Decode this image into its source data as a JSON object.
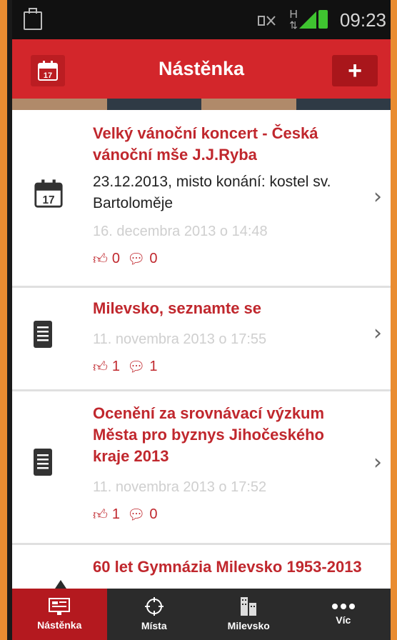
{
  "status_bar": {
    "time": "09:23",
    "network_label": "H"
  },
  "header": {
    "title": "Nástěnka",
    "calendar_day": "17",
    "add_symbol": "+"
  },
  "colors": {
    "accent": "#d3262b",
    "accent_dark": "#a9161b",
    "nav_bg": "#2b2b2b"
  },
  "items": [
    {
      "type": "event",
      "title": "Velký vánoční koncert - Česká vánoční mše J.J.Ryba",
      "description": "23.12.2013, misto konání:  kostel sv. Bartoloměje",
      "icon_day": "17",
      "date": "16. decembra 2013 o 14:48",
      "likes": "0",
      "comments": "0"
    },
    {
      "type": "article",
      "title": "Milevsko, seznamte se",
      "date": "11. novembra 2013 o 17:55",
      "likes": "1",
      "comments": "1"
    },
    {
      "type": "article",
      "title": "Ocenění za srovnávací výzkum Města pro byznys Jihočeského kraje 2013",
      "date": "11. novembra 2013 o 17:52",
      "likes": "1",
      "comments": "0"
    },
    {
      "type": "article",
      "title": "60 let Gymnázia Milevsko 1953-2013"
    }
  ],
  "bottom_nav": [
    {
      "label": "Nástěnka",
      "icon": "board-icon",
      "active": true
    },
    {
      "label": "Místa",
      "icon": "target-icon",
      "active": false
    },
    {
      "label": "Milevsko",
      "icon": "buildings-icon",
      "active": false
    },
    {
      "label": "Víc",
      "icon": "more-icon",
      "active": false
    }
  ]
}
